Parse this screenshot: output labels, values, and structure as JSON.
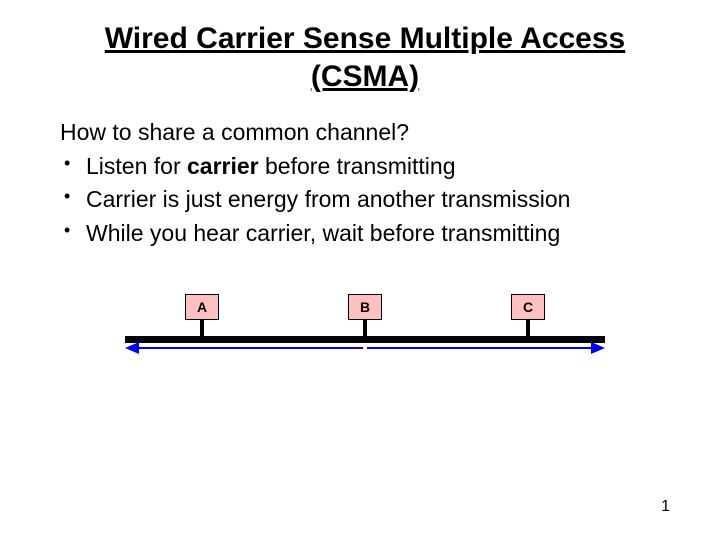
{
  "title_line1": "Wired Carrier Sense Multiple Access",
  "title_line2": "(CSMA)",
  "lead": "How to share a common channel?",
  "bullets": [
    {
      "pre": "Listen for ",
      "strong": "carrier",
      "post": " before transmitting"
    },
    {
      "pre": "Carrier is just energy from another transmission",
      "strong": "",
      "post": ""
    },
    {
      "pre": "While you hear carrier, wait before transmitting",
      "strong": "",
      "post": ""
    }
  ],
  "nodes": [
    "A",
    "B",
    "C"
  ],
  "page_number": "1"
}
